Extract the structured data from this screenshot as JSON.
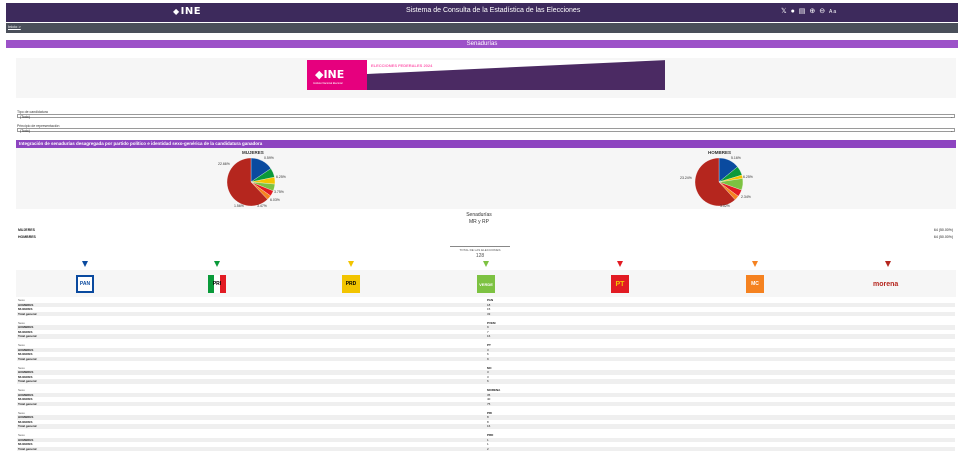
{
  "header": {
    "logo": "INE",
    "title": "Sistema de Consulta de la Estadística de las Elecciones",
    "tools": [
      "X",
      "f",
      "doc",
      "zoom-in",
      "zoom-out",
      "Aa"
    ]
  },
  "breadcrumb": "Inicio >",
  "section_title": "Senadurías",
  "banner": {
    "logo": "INE",
    "institute": "Instituto Nacional Electoral",
    "election": "ELECCIONES FEDERALES 2024"
  },
  "filters": [
    {
      "label": "Tipo de candidatura",
      "value": "(Todo)"
    },
    {
      "label": "Principio de representación",
      "value": "(Todo)"
    }
  ],
  "integration_title": "Integración de senadurías desagregada por partido político e identidad sexo-genérica de la candidatura ganadora",
  "colors": {
    "PAN": "#0a4a9f",
    "PRI": "#0a9a3a",
    "PRD": "#f2c400",
    "PVEM": "#7dc242",
    "PT": "#e21b23",
    "MC": "#f58220",
    "MORENA": "#b5261e"
  },
  "chart_data": [
    {
      "type": "pie",
      "title": "MUJERES",
      "labels": [
        "PAN",
        "PRI",
        "PRD",
        "PVEM",
        "PT",
        "MC",
        "MORENA"
      ],
      "values": [
        15.63,
        6.25,
        4.69,
        4.69,
        3.75,
        3.13,
        62.5
      ],
      "data_labels": [
        "0.59%",
        "6.25%",
        "3.75%",
        "6.03%",
        "3.47%",
        "1.56%",
        "22.66%"
      ]
    },
    {
      "type": "pie",
      "title": "HOMBRES",
      "labels": [
        "PAN",
        "PRI",
        "PRD",
        "PVEM",
        "PT",
        "MC",
        "MORENA"
      ],
      "values": [
        14.06,
        6.25,
        2.34,
        7.81,
        4.69,
        3.13,
        61.72
      ],
      "data_labels": [
        "5.16%",
        "6.25%",
        "2.34%",
        "3.52%",
        "23.24%"
      ]
    }
  ],
  "senate": {
    "title": "Senadurías",
    "subtitle": "MR y RP",
    "rows": [
      {
        "label": "MUJERES",
        "value": "64 (50.00%)"
      },
      {
        "label": "HOMBRES",
        "value": "64 (50.00%)"
      }
    ],
    "total_label": "TOTAL DE LAS ELECCIONES",
    "total_value": "128"
  },
  "party_marker_colors": [
    "#0a4a9f",
    "#0a9a3a",
    "#f2c400",
    "#7dc242",
    "#e21b23",
    "#f58220",
    "#b5261e"
  ],
  "party_logos": {
    "pan": "PAN",
    "pri": "PRI",
    "prd": "PRD",
    "pvem": "VERDE",
    "pt": "PT",
    "mc": "MC",
    "morena": "morena"
  },
  "party_table": {
    "row_label_sexo": "Sexo",
    "row_labels": [
      "HOMBRES",
      "MUJERES",
      "Total general"
    ],
    "blocks": [
      {
        "party": "PAN",
        "values": [
          "18",
          "15",
          "33"
        ]
      },
      {
        "party": "PVEM",
        "values": [
          "9",
          "7",
          "16"
        ]
      },
      {
        "party": "PT",
        "values": [
          "3",
          "6",
          "9"
        ]
      },
      {
        "party": "MC",
        "values": [
          "3",
          "3",
          "6"
        ]
      },
      {
        "party": "MORENA",
        "values": [
          "35",
          "40",
          "75"
        ]
      },
      {
        "party": "PRI",
        "values": [
          "8",
          "8",
          "16"
        ]
      },
      {
        "party": "PRD",
        "values": [
          "1",
          "1",
          "2"
        ]
      }
    ]
  }
}
